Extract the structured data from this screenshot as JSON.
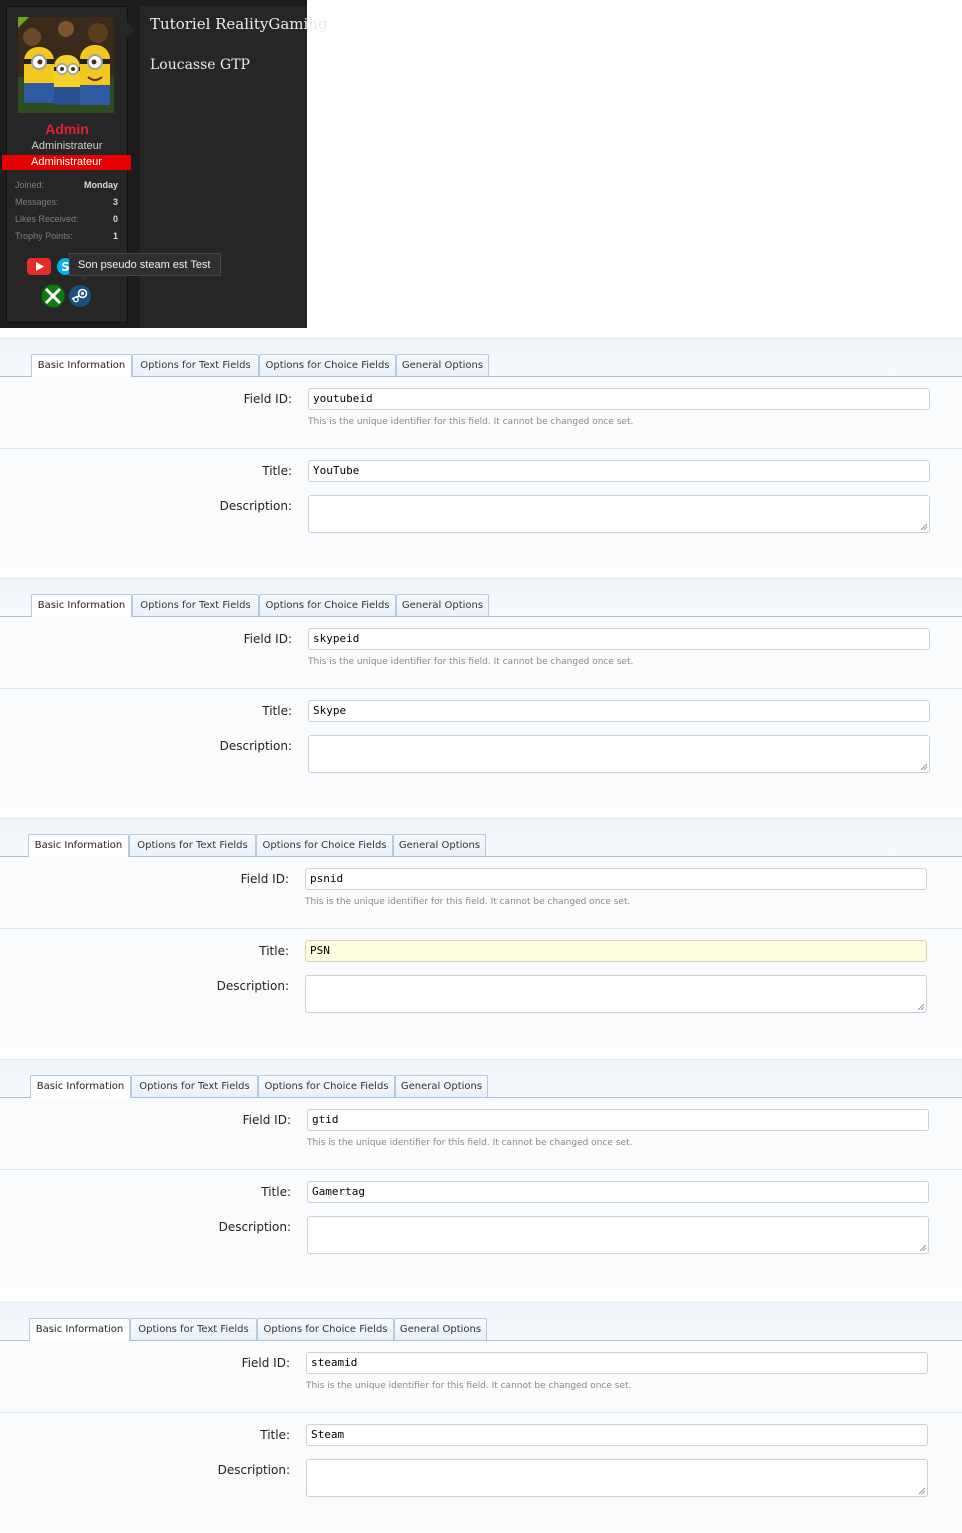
{
  "post": {
    "username": "Admin",
    "user_title": "Administrateur",
    "banner": "Administrateur",
    "stats": [
      {
        "label": "Joined:",
        "value": "Monday"
      },
      {
        "label": "Messages:",
        "value": "3"
      },
      {
        "label": "Likes Received:",
        "value": "0"
      },
      {
        "label": "Trophy Points:",
        "value": "1"
      }
    ],
    "tooltip": "Son pseudo steam est Test",
    "thread_title": "Tutoriel RealityGaming",
    "message": "Loucasse GTP",
    "social_icons": [
      "youtube-icon",
      "skype-icon",
      "xbox-icon",
      "steam-icon"
    ]
  },
  "tabs": [
    "Basic Information",
    "Options for Text Fields",
    "Options for Choice Fields",
    "General Options"
  ],
  "labels": {
    "field_id": "Field ID:",
    "title": "Title:",
    "description": "Description:",
    "hint": "This is the unique identifier for this field. It cannot be changed once set."
  },
  "forms": [
    {
      "field_id": "youtubeid",
      "title": "YouTube",
      "description": ""
    },
    {
      "field_id": "skypeid",
      "title": "Skype",
      "description": ""
    },
    {
      "field_id": "psnid",
      "title": "PSN",
      "description": ""
    },
    {
      "field_id": "gtid",
      "title": "Gamertag",
      "description": ""
    },
    {
      "field_id": "steamid",
      "title": "Steam",
      "description": ""
    }
  ],
  "colors": {
    "username": "#e0203a",
    "banner": "#e60000",
    "tab_border": "#b6cbe0",
    "focused_input": "#fefde0"
  }
}
